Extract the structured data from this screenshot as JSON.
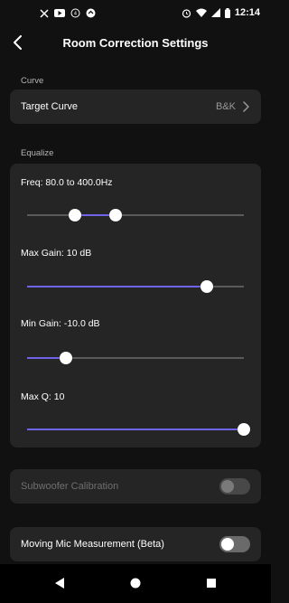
{
  "status_bar": {
    "time": "12:14",
    "left_icons": [
      "x-icon",
      "youtube-icon",
      "signal-icon",
      "sync-icon"
    ],
    "right_icons": [
      "alarm-icon",
      "wifi-icon",
      "cell-signal-icon",
      "battery-icon"
    ]
  },
  "header": {
    "title": "Room Correction Settings",
    "back_icon": "chevron-left-icon"
  },
  "curve": {
    "section_label": "Curve",
    "target_curve_label": "Target Curve",
    "target_curve_value": "B&K"
  },
  "equalize": {
    "section_label": "Equalize",
    "freq_label": "Freq: 80.0 to 400.0Hz",
    "freq_range_position": [
      0.22,
      0.41
    ],
    "max_gain_label": "Max Gain: 10 dB",
    "max_gain_position": 0.83,
    "min_gain_label": "Min Gain: -10.0 dB",
    "min_gain_position": 0.18,
    "max_q_label": "Max Q: 10",
    "max_q_position": 1.0
  },
  "subwoofer": {
    "label": "Subwoofer Calibration",
    "enabled": false,
    "on": false
  },
  "moving_mic": {
    "label": "Moving Mic Measurement (Beta)",
    "on": false
  },
  "nav_bar": {
    "back_icon": "triangle-back-icon",
    "home_icon": "circle-home-icon",
    "recents_icon": "square-recents-icon"
  },
  "colors": {
    "background": "#111111",
    "card": "#252525",
    "accent": "#6f63e8",
    "track": "#5a5a5a",
    "muted_text": "#b5b5b5"
  }
}
